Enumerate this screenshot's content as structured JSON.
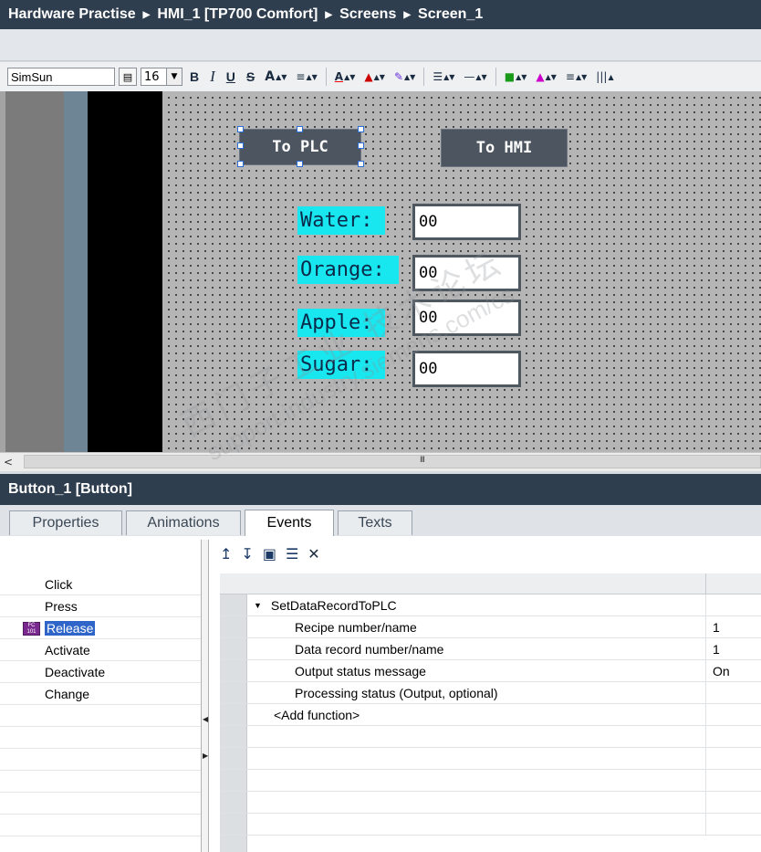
{
  "breadcrumb": [
    "Hardware Practise",
    "HMI_1 [TP700 Comfort]",
    "Screens",
    "Screen_1"
  ],
  "toolbar": {
    "font_name": "SimSun",
    "font_size": "16",
    "bold": "B",
    "italic": "I",
    "underline": "U",
    "strike": "S",
    "super": "A",
    "icons": [
      "align-text-icon",
      "font-color-icon",
      "fill-color-icon",
      "line-color-icon",
      "line-style-icon",
      "line-width-icon",
      "pattern-icon",
      "rotate-icon",
      "align-icon",
      "distribute-icon"
    ]
  },
  "screen": {
    "buttons": [
      {
        "label": "To PLC",
        "selected": true
      },
      {
        "label": "To HMI",
        "selected": false
      }
    ],
    "fields": [
      {
        "label": "Water:",
        "value": "00"
      },
      {
        "label": "Orange:",
        "value": "00"
      },
      {
        "label": "Apple:",
        "value": "00"
      },
      {
        "label": "Sugar:",
        "value": "00"
      }
    ],
    "scroll_grip": "III",
    "scroll_left": "<",
    "colors": {
      "label_bg": "#19e7f0",
      "button_bg": "#4d5560",
      "canvas_bg": "#b5b5b5"
    }
  },
  "inspector": {
    "title": "Button_1 [Button]",
    "tabs": [
      "Properties",
      "Animations",
      "Events",
      "Texts"
    ],
    "active_tab": "Events",
    "events": [
      "Click",
      "Press",
      "Release",
      "Activate",
      "Deactivate",
      "Change"
    ],
    "selected_event": "Release",
    "event_icon_text": "FC\n101",
    "function": {
      "name": "SetDataRecordToPLC",
      "params": [
        {
          "name": "Recipe number/name",
          "value": "1"
        },
        {
          "name": "Data record number/name",
          "value": "1"
        },
        {
          "name": "Output status message",
          "value": "On"
        },
        {
          "name": "Processing status (Output, optional)",
          "value": ""
        }
      ],
      "add_label": "<Add function>"
    }
  },
  "watermark": {
    "line1": "西门子工业 技术论坛",
    "line2": "support.industry.siemens.com/cs"
  }
}
